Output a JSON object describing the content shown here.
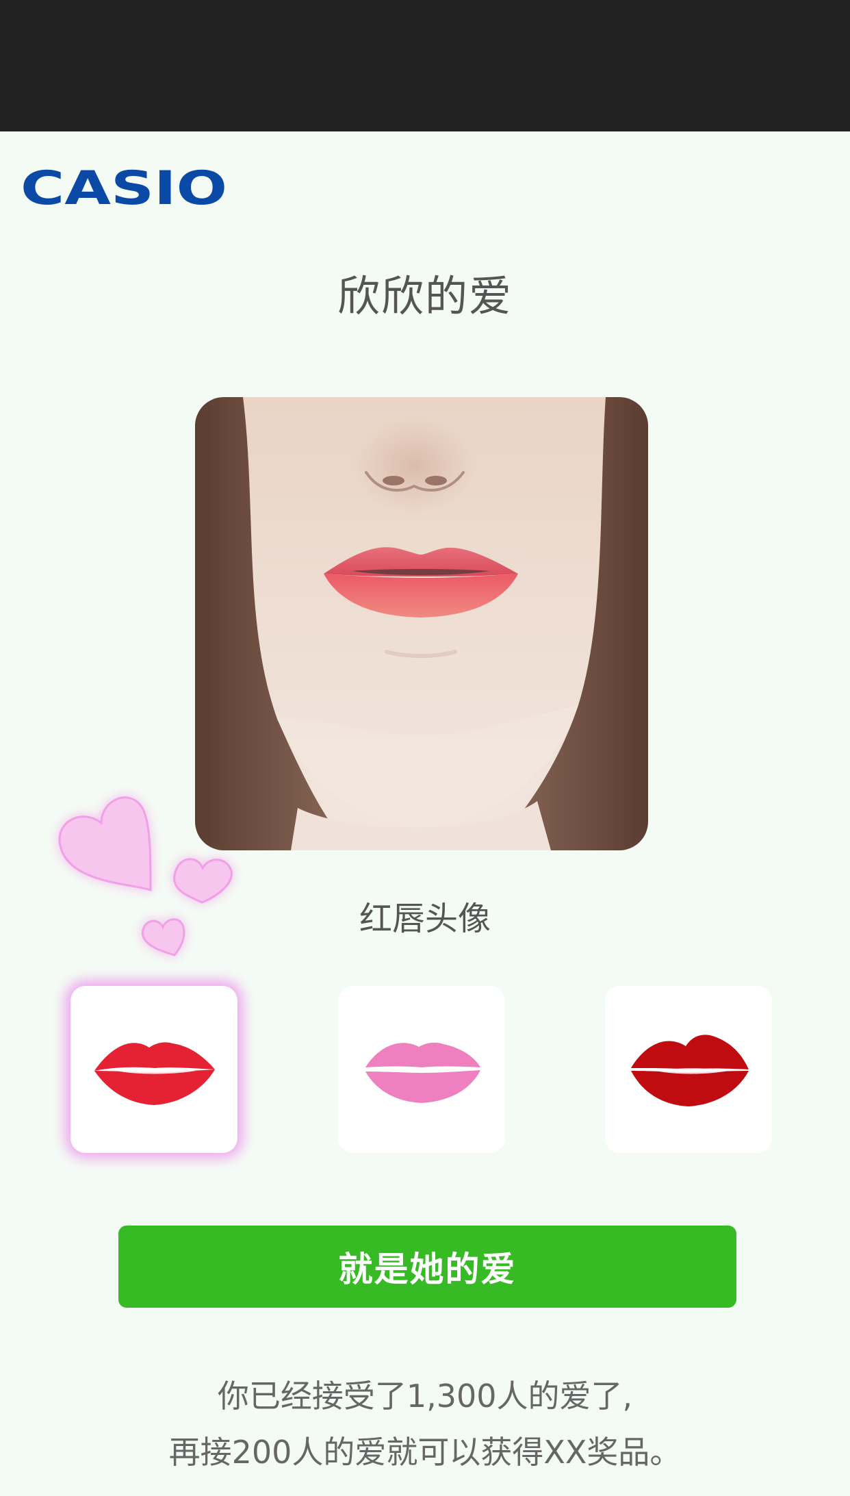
{
  "header": {
    "brand_logo": "CASIO",
    "title": "欣欣的爱"
  },
  "profile": {
    "caption": "红唇头像"
  },
  "lip_options": [
    {
      "name": "red-lips",
      "color": "#e42234",
      "selected": true
    },
    {
      "name": "pink-lips",
      "color": "#ee80c0",
      "selected": false
    },
    {
      "name": "dark-red-lips",
      "color": "#c00b10",
      "selected": false
    }
  ],
  "actions": {
    "confirm_label": "就是她的爱"
  },
  "footer": {
    "line1": "你已经接受了1,300人的爱了,",
    "line2": "再接200人的爱就可以获得XX奖品。"
  },
  "colors": {
    "accent_green": "#37bb25",
    "brand_blue": "#0a4aa6",
    "top_bar": "#222222",
    "heart_pink": "#f6c6ee"
  }
}
